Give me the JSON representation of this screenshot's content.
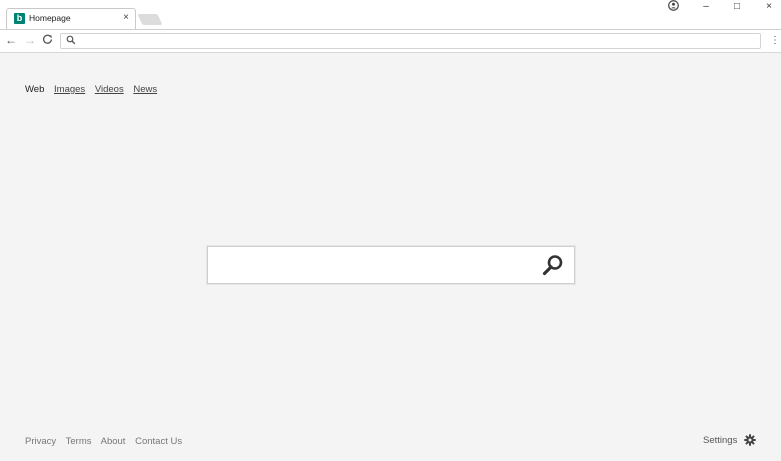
{
  "browser": {
    "tab": {
      "title": "Homepage",
      "favicon": "bing-logo-icon",
      "favicon_letter": "b",
      "close_glyph": "×"
    },
    "window_controls": {
      "account": "account-icon",
      "minimize": "–",
      "maximize": "□",
      "close": "×"
    },
    "toolbar": {
      "back": "←",
      "forward": "→",
      "reload": "C",
      "address_value": "",
      "address_placeholder": "",
      "menu": "⋮"
    }
  },
  "page": {
    "nav": [
      "Web",
      "Images",
      "Videos",
      "News"
    ],
    "search": {
      "value": "",
      "placeholder": "",
      "button_icon": "search-icon"
    },
    "footer": [
      "Privacy",
      "Terms",
      "About",
      "Contact Us"
    ],
    "settings": {
      "label": "Settings",
      "icon": "gear-icon"
    }
  },
  "colors": {
    "brand": "#008373",
    "background": "#f4f4f4"
  }
}
